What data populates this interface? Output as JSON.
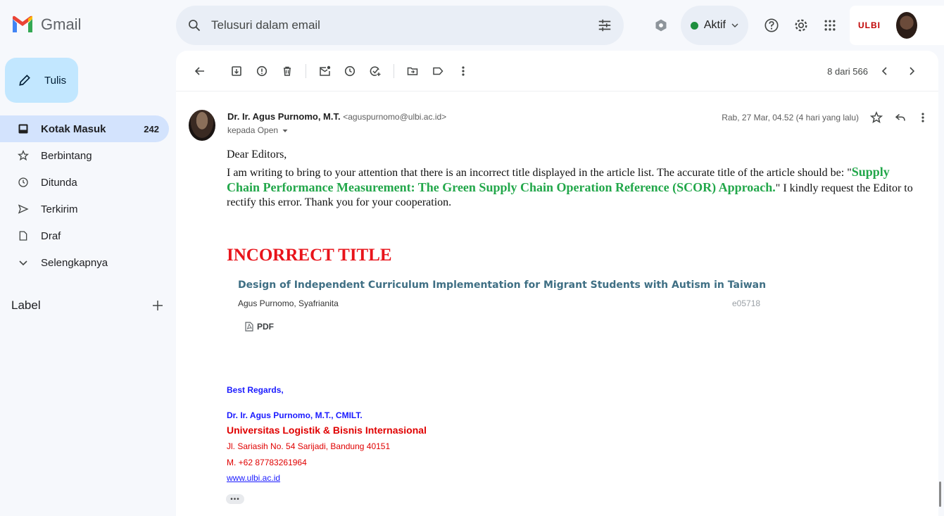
{
  "app": {
    "name": "Gmail"
  },
  "search": {
    "placeholder": "Telusuri dalam email"
  },
  "status": {
    "label": "Aktif"
  },
  "org": {
    "logo_text": "ULBI"
  },
  "compose": {
    "label": "Tulis"
  },
  "sidebar": {
    "items": [
      {
        "label": "Kotak Masuk",
        "count": "242",
        "icon": "inbox-icon"
      },
      {
        "label": "Berbintang",
        "count": "",
        "icon": "star-icon"
      },
      {
        "label": "Ditunda",
        "count": "",
        "icon": "clock-icon"
      },
      {
        "label": "Terkirim",
        "count": "",
        "icon": "send-icon"
      },
      {
        "label": "Draf",
        "count": "",
        "icon": "draft-icon"
      },
      {
        "label": "Selengkapnya",
        "count": "",
        "icon": "chevron-down-icon"
      }
    ],
    "label_heading": "Label"
  },
  "toolbar": {
    "paging": "8 dari 566"
  },
  "message": {
    "sender_name": "Dr. Ir. Agus Purnomo, M.T.",
    "sender_email": "<aguspurnomo@ulbi.ac.id>",
    "to": "kepada Open",
    "date": "Rab, 27 Mar, 04.52 (4 hari yang lalu)",
    "greeting": "Dear Editors,",
    "body_start": "I am writing to bring to your attention that there is an incorrect title displayed in the article list. The accurate title of the article should be: \"",
    "correct_title": "Supply Chain Performance Measurement: The Green Supply Chain Operation Reference (SCOR) Approach.",
    "body_end": "\" I kindly request the Editor to rectify this error. Thank you for your cooperation.",
    "incorrect_heading": "INCORRECT TITLE",
    "article_title": "Design of Independent Curriculum Implementation for Migrant Students with Autism in Taiwan",
    "article_authors": "Agus Purnomo, Syafrianita",
    "article_id": "e05718",
    "pdf_label": "PDF",
    "signature": {
      "closing": "Best Regards,",
      "name": "Dr. Ir. Agus Purnomo, M.T., CMILT.",
      "institution": "Universitas Logistik & Bisnis Internasional",
      "address": "Jl. Sariasih No. 54 Sarijadi, Bandung 40151",
      "phone": "M. +62 87783261964",
      "website": "www.ulbi.ac.id"
    },
    "more_label": "•••"
  },
  "colors": {
    "accent": "#c2e7ff",
    "active_nav": "#d3e3fd",
    "green_title": "#22a74a",
    "red": "#e8141b",
    "sig_blue": "#1a1aff"
  }
}
